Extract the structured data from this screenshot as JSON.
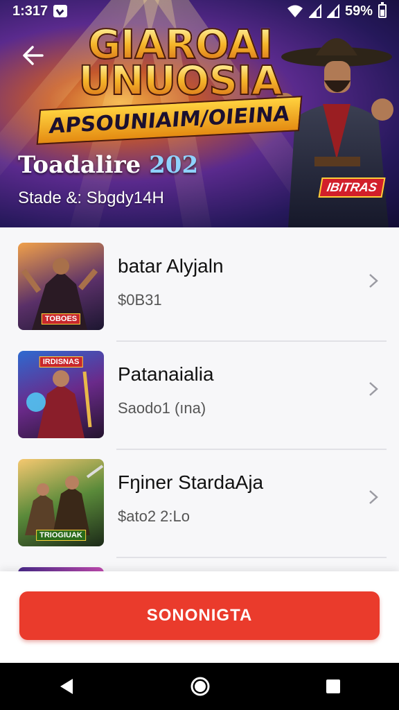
{
  "status_bar": {
    "time": "1:317",
    "battery": "59%"
  },
  "hero": {
    "logo_line1": "GIAROAI",
    "logo_line2": "UNUOSIA",
    "logo_ribbon": "APSOUNIAIM/OIEINA",
    "title": "Toadalire",
    "title_year": "202",
    "subtitle": "Stade &: Sbgdy14H",
    "brand_badge": "IBITRAS"
  },
  "list": {
    "items": [
      {
        "title": "batar Alyjaln",
        "subtitle": "$0B31",
        "badge": "TOBOES"
      },
      {
        "title": "Patanaialia",
        "subtitle": "Saodo1 (ına)",
        "badge": "IRDISNAS"
      },
      {
        "title": "Fŋiner StardaAja",
        "subtitle": "$ato2 2:Lo",
        "badge": "TRIOGIUAK"
      }
    ]
  },
  "cta": {
    "label": "SONONIGTA"
  },
  "colors": {
    "accent": "#ea3b2c",
    "hero_bg": "#25185a"
  }
}
